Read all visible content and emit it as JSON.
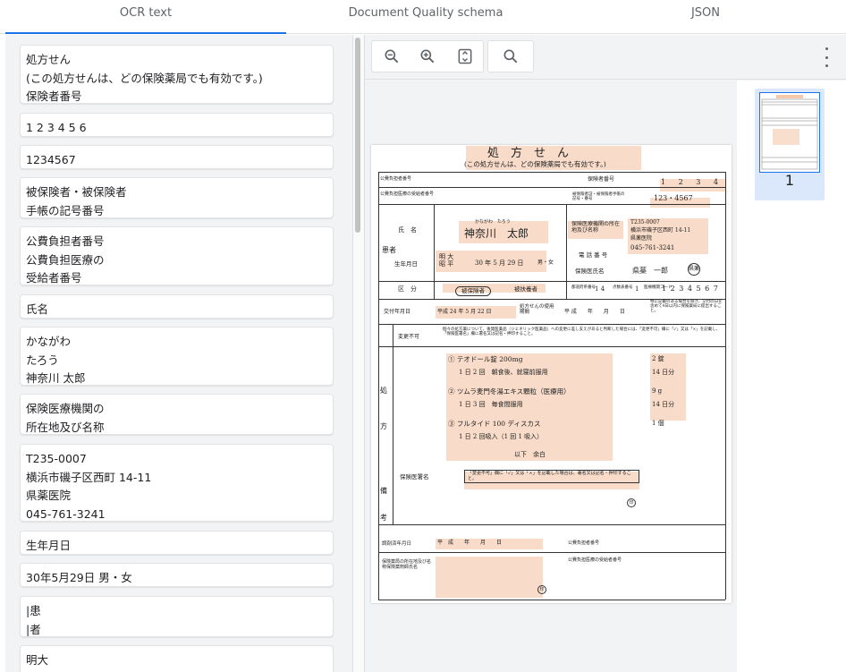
{
  "tabs": [
    {
      "label": "OCR text"
    },
    {
      "label": "Document Quality schema"
    },
    {
      "label": "JSON"
    }
  ],
  "ocr_blocks": [
    "処方せん\n(この処方せんは、どの保険薬局でも有効です。)\n保険者番号",
    "1 2 3 4 5 6",
    "1234567",
    "被保険者・被保険者\n手帳の記号番号",
    "公費負担者番号\n公費負担医療の\n受給者番号",
    "氏名",
    "かながわ\nたろう\n神奈川 太郎",
    "保険医療機関の\n所在地及び名称",
    "T235-0007\n横浜市磯子区西町 14-11\n県薬医院\n045-761-3241",
    "生年月日",
    "30年5月29日 男・女",
    "|患\n|者",
    "明大"
  ],
  "toolbar": {
    "icons": [
      "zoom-out-icon",
      "zoom-in-icon",
      "fit-page-icon",
      "search-icon",
      "more-vert-icon"
    ]
  },
  "thumbnail": {
    "page_number": "1"
  },
  "document": {
    "title": "処　方　せ　ん",
    "subtitle": "(この処方せんは、どの保険薬局でも有効です。)",
    "insurer_label": "保険者番号",
    "insurer_digits": [
      "1",
      "2",
      "3",
      "4",
      "5",
      "6"
    ],
    "public_payer_label": "公費負担者番号",
    "public_recipient_label": "公費負担医療の受給者番号",
    "insured_label": "被保険者証・被保険者手帳の記号・番号",
    "insured_number": "123・4567",
    "patient_side_label": "患者",
    "name_label": "氏　名",
    "name_kana": "かながわ　たろう",
    "name": "神奈川　太郎",
    "birth_label": "生年月日",
    "birth_era": "明 大\n昭 平",
    "birth_date": "30 年 5 月 29 日",
    "sex": "男・女",
    "category_label": "区　分",
    "category_insured": "被保険者",
    "category_dependent": "被扶養者",
    "institution_label": "保険医療機関の所在地及び名称",
    "institution_address": "T235-0007\n横浜市磯子区西町 14-11\n県薬医院",
    "phone_label": "電 話 番 号",
    "phone": "045-761-3241",
    "doctor_label": "保険医氏名",
    "doctor_name": "県薬　一郎",
    "seal": "県薬",
    "pref_code_label": "都道府県番号",
    "pref_code": "1 4",
    "score_table_label": "点数表番号",
    "score_table": "1",
    "inst_code_label": "医療機関コード",
    "inst_code": "1 2 3 4 5 6 7",
    "issue_date_label": "交付年月日",
    "issue_date": "平成 24 年 5 月 22 日",
    "valid_label": "処方せんの使用期間",
    "valid_value": "平 成　　年　　月　　日",
    "valid_note": "特に記載のある場合を除き、交付の日を含めて4日以内に保険薬局に提出すること。",
    "change_label": "変更不可",
    "change_note": "個々の処方薬について、後発医薬品（ジェネリック医薬品）への変更に差し支えがあると判断した場合には、「変更不可」欄に「✓」又は「×」を記載し、「保険医署名」欄に署名又は記名・押印すること。",
    "rx_side": "処方",
    "rx": [
      {
        "line1": "① テオドール錠 200mg",
        "line2": "1 日 2 回　朝食後、就寝前服用",
        "qty": "2 錠",
        "days": "14 日分"
      },
      {
        "line1": "② ツムラ麦門冬湯エキス顆粒（医療用）",
        "line2": "1 日 3 回　毎食間服用",
        "qty": "9 g",
        "days": "14 日分"
      },
      {
        "line1": "③ フルタイド 100 ディスカス",
        "line2": "1 日 2 回吸入（1 回 1 吸入）",
        "qty": "1 個",
        "days": ""
      }
    ],
    "rx_end": "以下　余白",
    "remarks_side": "備考",
    "doctor_sign_label": "保険医署名",
    "doctor_sign_note": "「変更不可」欄に「✓」又は「×」を記載した場合は、署名又は記名・押印すること。",
    "dispense_date_label": "調剤済年月日",
    "dispense_date": "平　成　　年　　月　　日",
    "pharmacy_label": "保険薬局の所在地及び名称保険薬剤師氏名",
    "bottom_public_payer": "公費負担者番号",
    "bottom_public_recipient": "公費負担医療の受給者番号",
    "stamp": "印"
  }
}
